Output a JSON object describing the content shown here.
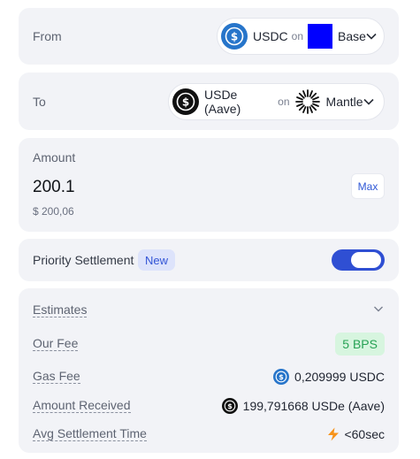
{
  "from": {
    "label": "From",
    "token": "USDC",
    "on": "on",
    "chain": "Base",
    "token_icon": "usdc-icon",
    "chain_icon": "base-icon",
    "chain_color": "#0000ff"
  },
  "to": {
    "label": "To",
    "token": "USDe (Aave)",
    "on": "on",
    "chain": "Mantle",
    "token_icon": "usde-icon",
    "chain_icon": "mantle-icon"
  },
  "amount": {
    "label": "Amount",
    "value": "200.1",
    "usd": "$ 200,06",
    "max_label": "Max"
  },
  "priority": {
    "label": "Priority Settlement",
    "badge": "New",
    "enabled": true,
    "accent": "#2f4fd3"
  },
  "estimates": {
    "title": "Estimates",
    "our_fee": {
      "label": "Our Fee",
      "value": "5 BPS"
    },
    "gas_fee": {
      "label": "Gas Fee",
      "value": "0,209999 USDC"
    },
    "amount_received": {
      "label": "Amount Received",
      "value": "199,791668 USDe (Aave)"
    },
    "avg_time": {
      "label": "Avg Settlement Time",
      "value": "<60sec"
    }
  }
}
